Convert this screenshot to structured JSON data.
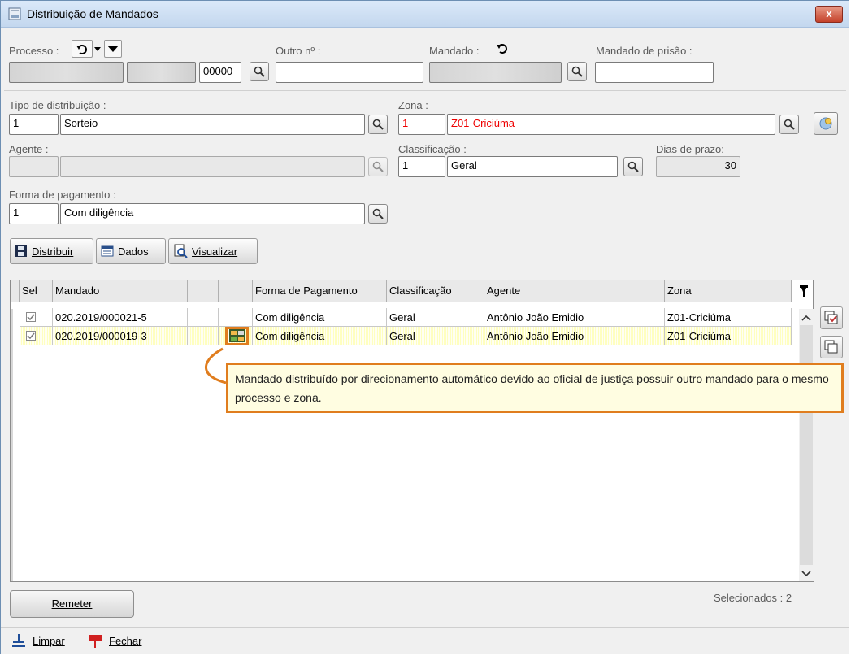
{
  "window": {
    "title": "Distribuição de Mandados",
    "close": "x"
  },
  "header": {
    "processo_label": "Processo :",
    "processo_suffix": "00000",
    "outro_label": "Outro nº :",
    "mandado_label": "Mandado :",
    "prisao_label": "Mandado de prisão :"
  },
  "form": {
    "tipo_label": "Tipo de distribuição :",
    "tipo_code": "1",
    "tipo_value": "Sorteio",
    "zona_label": "Zona :",
    "zona_code": "1",
    "zona_value": "Z01-Criciúma",
    "agente_label": "Agente :",
    "classificacao_label": "Classificação :",
    "classificacao_code": "1",
    "classificacao_value": "Geral",
    "dias_label": "Dias de prazo:",
    "dias_value": "30",
    "forma_label": "Forma de pagamento :",
    "forma_code": "1",
    "forma_value": "Com diligência"
  },
  "toolbar": {
    "distribuir": "Distribuir",
    "dados": "Dados",
    "visualizar": "Visualizar"
  },
  "grid": {
    "columns": [
      "Sel",
      "Mandado",
      "",
      "",
      "Forma de Pagamento",
      "Classificação",
      "Agente",
      "Zona"
    ],
    "rows": [
      {
        "mandado": "020.2019/000021-5",
        "forma": "Com diligência",
        "classificacao": "Geral",
        "agente": "Antônio João Emidio",
        "zona": "Z01-Criciúma",
        "checked": true
      },
      {
        "mandado": "020.2019/000019-3",
        "forma": "Com diligência",
        "classificacao": "Geral",
        "agente": "Antônio João Emidio",
        "zona": "Z01-Criciúma",
        "checked": true
      }
    ]
  },
  "tooltip": {
    "text": "Mandado distribuído por direcionamento automático devido ao oficial de justiça possuir outro mandado para o mesmo processo e zona."
  },
  "footer": {
    "selecionados": "Selecionados : 2",
    "remeter": "Remeter",
    "limpar": "Limpar",
    "fechar": "Fechar"
  },
  "colors": {
    "accent": "#e07d1e",
    "zona_text": "#ee0000",
    "selected_row": "#ffffc0"
  }
}
